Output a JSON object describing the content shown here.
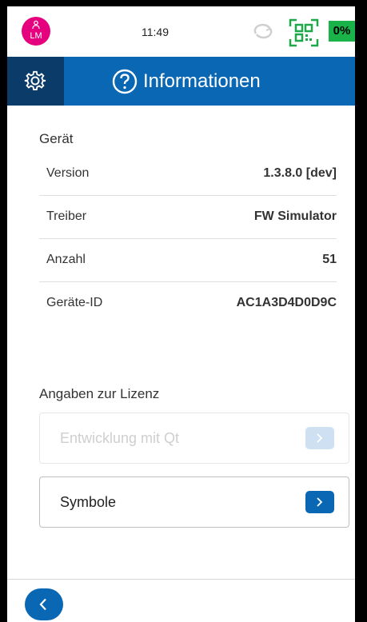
{
  "statusbar": {
    "avatar_initials": "LM",
    "time": "11:49",
    "battery": "0%",
    "icons": {
      "avatar": "person-icon",
      "sync": "sync-icon",
      "qr": "qr-code-icon"
    }
  },
  "header": {
    "title": "Informationen",
    "icons": {
      "settings": "gear-icon",
      "help": "help-circle-icon"
    }
  },
  "device": {
    "section_title": "Gerät",
    "rows": [
      {
        "label": "Version",
        "value": "1.3.8.0 [dev]"
      },
      {
        "label": "Treiber",
        "value": "FW Simulator"
      },
      {
        "label": "Anzahl",
        "value": "51"
      },
      {
        "label": "Geräte-ID",
        "value": "AC1A3D4D0D9C"
      }
    ]
  },
  "license": {
    "section_title": "Angaben zur Lizenz",
    "items": [
      {
        "label": "Entwicklung mit Qt",
        "enabled": false
      },
      {
        "label": "Symbole",
        "enabled": true
      }
    ]
  },
  "footer": {
    "back_icon": "chevron-left-icon"
  },
  "colors": {
    "primary": "#0a67b4",
    "primary_dark": "#0b3b69",
    "avatar": "#e5007e",
    "battery": "#19b34a",
    "qr": "#1fa84a"
  }
}
